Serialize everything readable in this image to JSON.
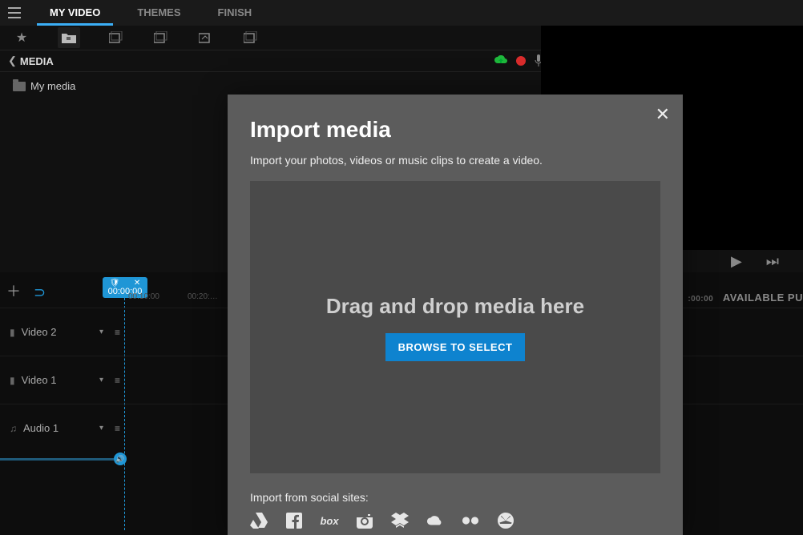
{
  "tabs": {
    "my_video": "MY VIDEO",
    "themes": "THEMES",
    "finish": "FINISH"
  },
  "media": {
    "header": "MEDIA",
    "folder": "My media",
    "search_placeholder": ""
  },
  "timeline": {
    "playhead": "00:00:00",
    "ticks": [
      "00:10:00",
      "00:20:…"
    ],
    "avail_time": ":00:00",
    "avail_label": "AVAILABLE PU",
    "tracks": {
      "video2": "Video 2",
      "video1": "Video 1",
      "audio1": "Audio 1"
    }
  },
  "modal": {
    "title": "Import media",
    "subtitle": "Import your photos, videos or music clips to create a video.",
    "drop_msg": "Drag and drop media here",
    "browse": "BROWSE TO SELECT",
    "social_label": "Import from social sites:"
  }
}
